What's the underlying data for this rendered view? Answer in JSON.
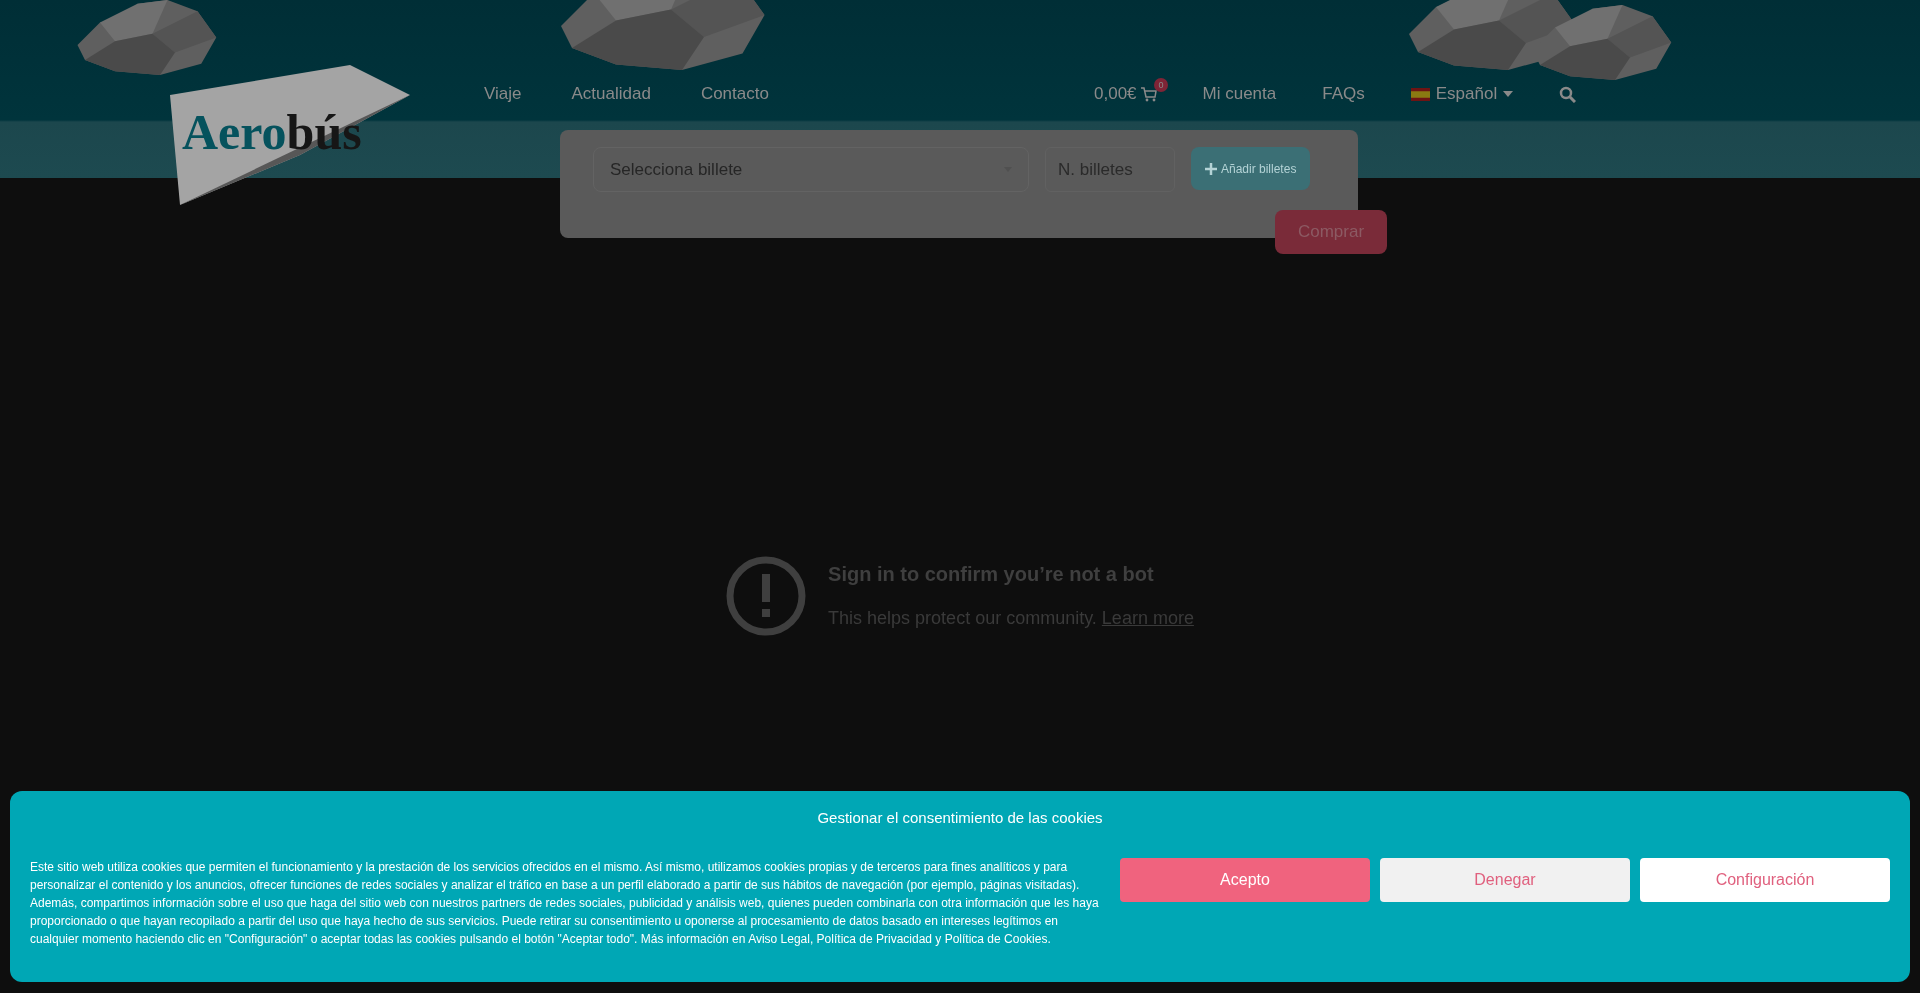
{
  "header": {
    "logo": {
      "part_1": "Aero",
      "part_2": "bús"
    },
    "nav": [
      {
        "label": "Viaje"
      },
      {
        "label": "Actualidad"
      },
      {
        "label": "Contacto"
      }
    ],
    "cart": {
      "total": "0,00€",
      "badge": "0"
    },
    "account": "Mi cuenta",
    "faqs": "FAQs",
    "language": "Español"
  },
  "ticket_form": {
    "select_placeholder": "Selecciona billete",
    "quantity_placeholder": "N. billetes",
    "add_button": "Añadir billetes",
    "buy_button": "Comprar"
  },
  "notice": {
    "title": "Sign in to confirm you’re not a bot",
    "text": "This helps protect our community.",
    "link": "Learn more"
  },
  "cookie_banner": {
    "title": "Gestionar el consentimiento de las cookies",
    "text": "Este sitio web utiliza cookies que permiten el funcionamiento y la prestación de los servicios ofrecidos en el mismo. Así mismo, utilizamos cookies propias y de terceros para fines analíticos y para personalizar el contenido y los anuncios, ofrecer funciones de redes sociales y analizar el tráfico en base a un perfil elaborado a partir de sus hábitos de navegación (por ejemplo, páginas visitadas). Además, compartimos información sobre el uso que haga del sitio web con nuestros partners de redes sociales, publicidad y análisis web, quienes pueden combinarla con otra información que les haya proporcionado o que hayan recopilado a partir del uso que haya hecho de sus servicios. Puede retirar su consentimiento u oponerse al procesamiento de datos basado en intereses legítimos en cualquier momento haciendo clic en \"Configuración\" o aceptar todas las cookies pulsando el botón \"Aceptar todo\". Más información en Aviso Legal, Política de Privacidad y Política de Cookies.",
    "buttons": [
      {
        "label": "Acepto",
        "kind": "primary"
      },
      {
        "label": "Denegar",
        "kind": "secondary"
      },
      {
        "label": "Configuración",
        "kind": "outline"
      }
    ]
  }
}
